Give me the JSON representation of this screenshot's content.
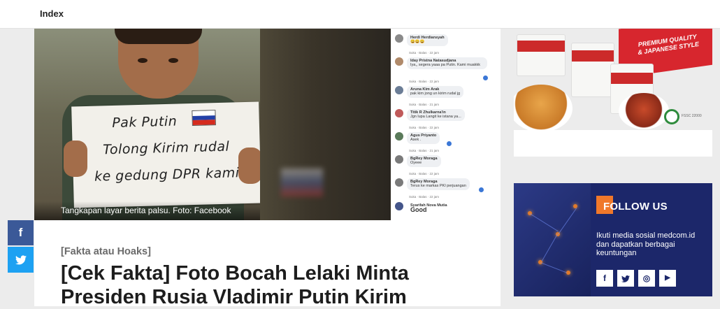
{
  "nav": {
    "index_label": "Index"
  },
  "hero": {
    "sign_lines": [
      "Pak Putin",
      "Tolong Kirim rudal",
      "ke gedung DPR kami"
    ],
    "caption": "Tangkapan layar berita palsu. Foto: Facebook"
  },
  "fb_comments": [
    {
      "name": "Herdi Herdiansyah",
      "text": "😀😀😀",
      "meta": "Suka · Balas · 22 jam"
    },
    {
      "name": "Iday Pristna Natasudjana",
      "text": "Iya,, segera yaaa pa Putin. Kami muakkk",
      "meta": "Suka · Balas · 22 jam"
    },
    {
      "name": "Aruna Kim Arak",
      "text": "pak kim jong un kirim rudal jg",
      "meta": "Suka · Balas · 21 jam"
    },
    {
      "name": "Titik R Zhulkarna'in",
      "text": "Jgn lupa Langit ke istana ya...",
      "meta": "Suka · Balas · 22 jam"
    },
    {
      "name": "Agus Priyanto",
      "text": "Asek .",
      "meta": "Suka · Balas · 21 jam"
    },
    {
      "name": "BgRey Moraga",
      "text": "Oyeee",
      "meta": "Suka · Balas · 22 jam"
    },
    {
      "name": "BgRey Moraga",
      "text": "Terus ke markas PKI perjuangan",
      "meta": "Suka · Balas · 22 jam"
    },
    {
      "name": "Syarifah Nova Mutia",
      "text": "Good",
      "meta": ""
    }
  ],
  "article": {
    "kicker": "[Fakta atau Hoaks]",
    "headline_line1": "[Cek Fakta] Foto Bocah Lelaki Minta",
    "headline_line2": "Presiden Rusia Vladimir Putin Kirim"
  },
  "share": {
    "facebook_glyph": "f",
    "twitter_glyph": "🐦"
  },
  "ad": {
    "slogan_line1": "PREMIUM QUALITY",
    "slogan_line2": "& JAPANESE STYLE",
    "certification": "FSSC 22000"
  },
  "follow": {
    "title": "FOLLOW US",
    "description": "Ikuti media sosial medcom.id dan dapatkan berbagai keuntungan",
    "socials": [
      {
        "icon": "facebook-icon",
        "glyph": "f"
      },
      {
        "icon": "twitter-icon",
        "glyph": "t"
      },
      {
        "icon": "instagram-icon",
        "glyph": "◎"
      },
      {
        "icon": "youtube-icon",
        "glyph": "▶"
      }
    ]
  },
  "colors": {
    "facebook": "#3b5998",
    "twitter": "#1da1f2",
    "follow_bg": "#1c276a",
    "accent_orange": "#f0782a",
    "ad_red": "#d7262e"
  }
}
